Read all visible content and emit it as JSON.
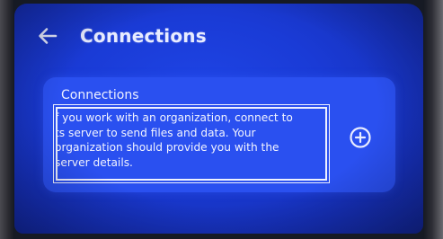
{
  "header": {
    "back_icon": "arrow-left-icon",
    "title": "Connections"
  },
  "card": {
    "title": "Connections",
    "description_lines": [
      "f you work with an organization, connect to",
      "ts server to send files and data. Your",
      "organization should provide you with the",
      "server details."
    ],
    "add_icon": "plus-circle-icon"
  },
  "colors": {
    "screen_background": "#1a3bd6",
    "card_background": "#2a50f0",
    "text": "#eef1ff"
  }
}
